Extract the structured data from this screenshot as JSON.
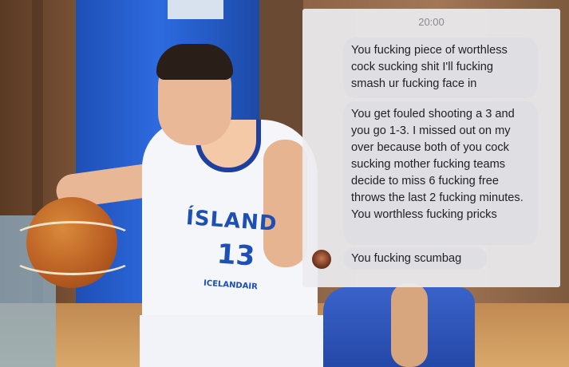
{
  "photo": {
    "jersey_text": "ÍSLAND",
    "jersey_number": "13",
    "sponsor_text": "ICELANDAIR"
  },
  "chat": {
    "time": "20:00",
    "messages": [
      {
        "text": "You fucking piece of worthless cock sucking shit I'll fucking smash ur fucking face in"
      },
      {
        "text": "You get fouled shooting a 3 and you go 1-3. I missed out on my over because both of you cock sucking mother fucking teams decide to miss 6 fucking free throws the last 2 fucking minutes. You worthless fucking pricks"
      },
      {
        "text": "You fucking scumbag"
      }
    ],
    "avatar_icon": "profile-photo-avatar"
  }
}
